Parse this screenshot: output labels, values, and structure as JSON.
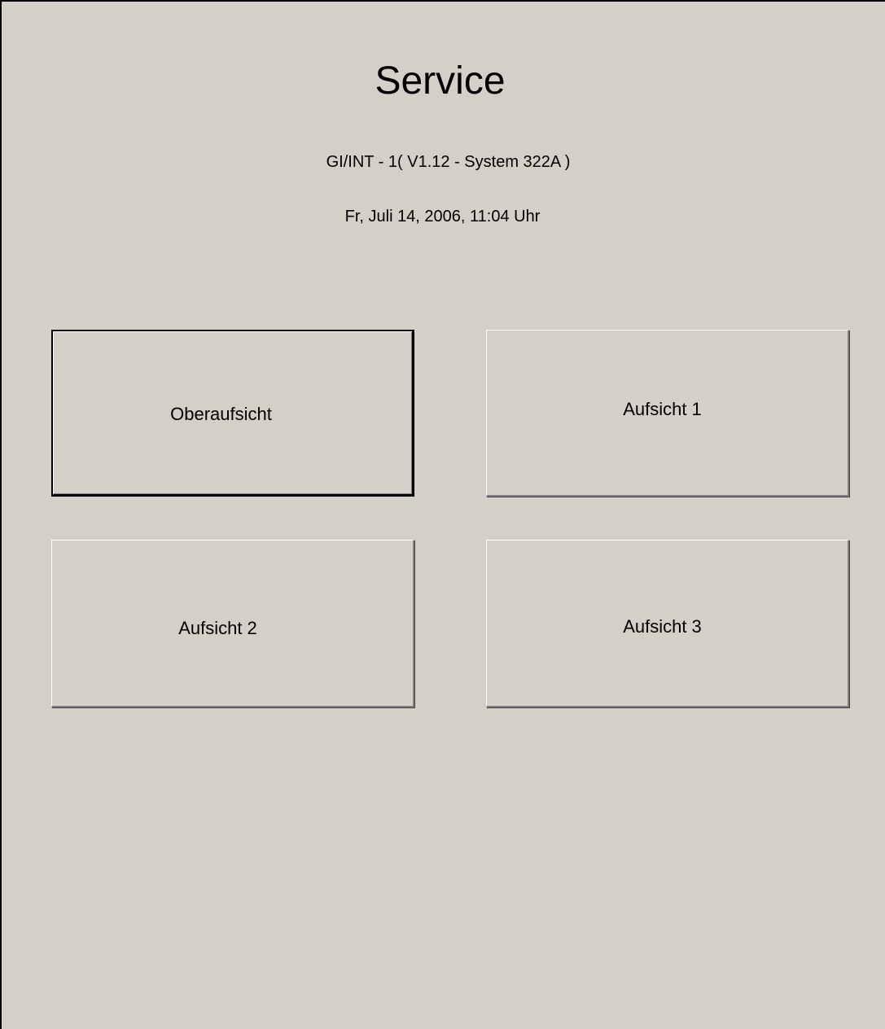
{
  "header": {
    "title": "Service",
    "version": "GI/INT - 1( V1.12 - System 322A )",
    "datetime": "Fr, Juli 14, 2006, 11:04 Uhr"
  },
  "buttons": [
    {
      "label": "Oberaufsicht",
      "focused": true
    },
    {
      "label": "Aufsicht 1",
      "focused": false
    },
    {
      "label": "Aufsicht 2",
      "focused": false
    },
    {
      "label": "Aufsicht 3",
      "focused": false
    }
  ],
  "colors": {
    "background": "#d4d0c8",
    "text": "#000000"
  }
}
